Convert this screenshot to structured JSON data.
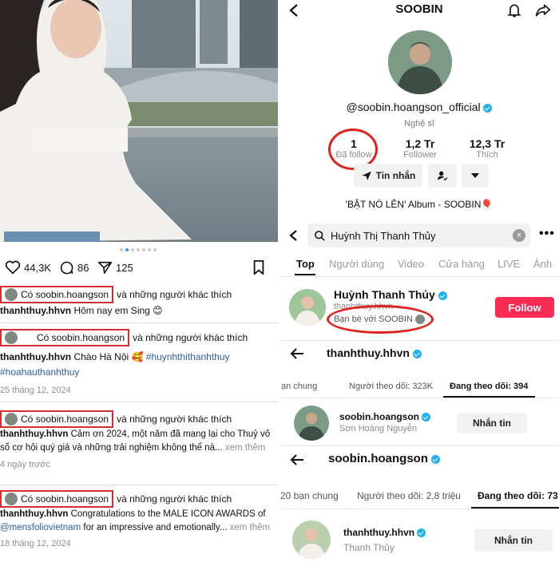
{
  "left": {
    "like_count": "44,3K",
    "comment_count": "86",
    "share_count": "125",
    "posts": [
      {
        "liker": "Có soobin.hoangson",
        "like_suffix": "và những người khác thích",
        "author": "thanhthuy.hhvn",
        "caption": "Hôm nay em Sing 😊",
        "date": ""
      },
      {
        "liker": "Có soobin.hoangson",
        "like_suffix": "và những người khác thích",
        "author": "thanhthuy.hhvn",
        "caption": "Chào Hà Nội 🥰",
        "tag1": "#huynhthithanhthuy",
        "tag2": "#hoahauthanhthuy",
        "date": "25 tháng 12, 2024"
      },
      {
        "liker": "Có soobin.hoangson",
        "like_suffix": "và những người khác thích",
        "author": "thanhthuy.hhvn",
        "caption": "Cảm ơn 2024, một năm đã mang lại cho Thuỷ vô số cơ hội quý giá và những trải nghiệm không thể nà...",
        "more": "xem thêm",
        "date": "4 ngày trước"
      },
      {
        "liker": "Có soobin.hoangson",
        "like_suffix": "và những người khác thích",
        "author": "thanhthuy.hhvn",
        "caption": "Congratulations to the MALE ICON AWARDS of",
        "mention": "@mensfoliovietnam",
        "caption2": "for an impressive and emotionally...",
        "more": "xem thêm",
        "date": "18 tháng 12, 2024"
      }
    ]
  },
  "profile": {
    "title": "SOOBIN",
    "username": "@soobin.hoangson_official",
    "role": "Nghệ sĩ",
    "following_count": "1",
    "following_label": "Đã follow",
    "followers_count": "1,2 Tr",
    "followers_label": "Follower",
    "likes_count": "12,3 Tr",
    "likes_label": "Thích",
    "message_button": "Tin nhắn",
    "album_text": "'BẬT NÓ LÊN' Album - SOOBIN🎈"
  },
  "search": {
    "query": "Huỳnh Thị Thanh Thủy",
    "tabs": [
      "Top",
      "Người dùng",
      "Video",
      "Cửa hàng",
      "LIVE",
      "Ảnh"
    ],
    "result_name": "Huỳnh Thanh Thủy",
    "result_handle": "thanhthuy.hhvn",
    "result_friend": "Bạn bè với SOOBIN",
    "follow_button": "Follow"
  },
  "following1": {
    "header": "thanhthuy.hhvn",
    "tab1": "ạn chung",
    "tab2": "Người theo dõi: 323K",
    "tab3": "Đang theo dõi: 394",
    "user": "soobin.hoangson",
    "user_sub": "Sơn Hoàng Nguyễn",
    "button": "Nhắn tin"
  },
  "following2": {
    "header": "soobin.hoangson",
    "tab1": "20 bạn chung",
    "tab2": "Người theo dõi: 2,8 triệu",
    "tab3": "Đang theo dõi: 73",
    "user": "thanhthuy.hhvn",
    "user_sub": "Thanh Thủy",
    "button": "Nhắn tin"
  },
  "colors": {
    "accent": "#fe2c55",
    "highlight": "#e0211d",
    "verified": "#20b0ee"
  }
}
